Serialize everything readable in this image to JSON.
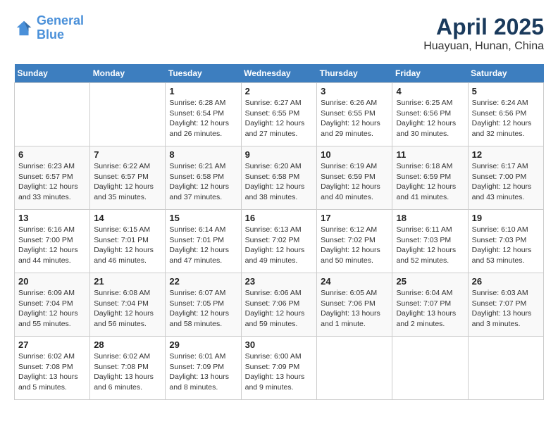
{
  "header": {
    "logo_line1": "General",
    "logo_line2": "Blue",
    "month": "April 2025",
    "location": "Huayuan, Hunan, China"
  },
  "weekdays": [
    "Sunday",
    "Monday",
    "Tuesday",
    "Wednesday",
    "Thursday",
    "Friday",
    "Saturday"
  ],
  "weeks": [
    [
      {
        "day": "",
        "info": ""
      },
      {
        "day": "",
        "info": ""
      },
      {
        "day": "1",
        "info": "Sunrise: 6:28 AM\nSunset: 6:54 PM\nDaylight: 12 hours\nand 26 minutes."
      },
      {
        "day": "2",
        "info": "Sunrise: 6:27 AM\nSunset: 6:55 PM\nDaylight: 12 hours\nand 27 minutes."
      },
      {
        "day": "3",
        "info": "Sunrise: 6:26 AM\nSunset: 6:55 PM\nDaylight: 12 hours\nand 29 minutes."
      },
      {
        "day": "4",
        "info": "Sunrise: 6:25 AM\nSunset: 6:56 PM\nDaylight: 12 hours\nand 30 minutes."
      },
      {
        "day": "5",
        "info": "Sunrise: 6:24 AM\nSunset: 6:56 PM\nDaylight: 12 hours\nand 32 minutes."
      }
    ],
    [
      {
        "day": "6",
        "info": "Sunrise: 6:23 AM\nSunset: 6:57 PM\nDaylight: 12 hours\nand 33 minutes."
      },
      {
        "day": "7",
        "info": "Sunrise: 6:22 AM\nSunset: 6:57 PM\nDaylight: 12 hours\nand 35 minutes."
      },
      {
        "day": "8",
        "info": "Sunrise: 6:21 AM\nSunset: 6:58 PM\nDaylight: 12 hours\nand 37 minutes."
      },
      {
        "day": "9",
        "info": "Sunrise: 6:20 AM\nSunset: 6:58 PM\nDaylight: 12 hours\nand 38 minutes."
      },
      {
        "day": "10",
        "info": "Sunrise: 6:19 AM\nSunset: 6:59 PM\nDaylight: 12 hours\nand 40 minutes."
      },
      {
        "day": "11",
        "info": "Sunrise: 6:18 AM\nSunset: 6:59 PM\nDaylight: 12 hours\nand 41 minutes."
      },
      {
        "day": "12",
        "info": "Sunrise: 6:17 AM\nSunset: 7:00 PM\nDaylight: 12 hours\nand 43 minutes."
      }
    ],
    [
      {
        "day": "13",
        "info": "Sunrise: 6:16 AM\nSunset: 7:00 PM\nDaylight: 12 hours\nand 44 minutes."
      },
      {
        "day": "14",
        "info": "Sunrise: 6:15 AM\nSunset: 7:01 PM\nDaylight: 12 hours\nand 46 minutes."
      },
      {
        "day": "15",
        "info": "Sunrise: 6:14 AM\nSunset: 7:01 PM\nDaylight: 12 hours\nand 47 minutes."
      },
      {
        "day": "16",
        "info": "Sunrise: 6:13 AM\nSunset: 7:02 PM\nDaylight: 12 hours\nand 49 minutes."
      },
      {
        "day": "17",
        "info": "Sunrise: 6:12 AM\nSunset: 7:02 PM\nDaylight: 12 hours\nand 50 minutes."
      },
      {
        "day": "18",
        "info": "Sunrise: 6:11 AM\nSunset: 7:03 PM\nDaylight: 12 hours\nand 52 minutes."
      },
      {
        "day": "19",
        "info": "Sunrise: 6:10 AM\nSunset: 7:03 PM\nDaylight: 12 hours\nand 53 minutes."
      }
    ],
    [
      {
        "day": "20",
        "info": "Sunrise: 6:09 AM\nSunset: 7:04 PM\nDaylight: 12 hours\nand 55 minutes."
      },
      {
        "day": "21",
        "info": "Sunrise: 6:08 AM\nSunset: 7:04 PM\nDaylight: 12 hours\nand 56 minutes."
      },
      {
        "day": "22",
        "info": "Sunrise: 6:07 AM\nSunset: 7:05 PM\nDaylight: 12 hours\nand 58 minutes."
      },
      {
        "day": "23",
        "info": "Sunrise: 6:06 AM\nSunset: 7:06 PM\nDaylight: 12 hours\nand 59 minutes."
      },
      {
        "day": "24",
        "info": "Sunrise: 6:05 AM\nSunset: 7:06 PM\nDaylight: 13 hours\nand 1 minute."
      },
      {
        "day": "25",
        "info": "Sunrise: 6:04 AM\nSunset: 7:07 PM\nDaylight: 13 hours\nand 2 minutes."
      },
      {
        "day": "26",
        "info": "Sunrise: 6:03 AM\nSunset: 7:07 PM\nDaylight: 13 hours\nand 3 minutes."
      }
    ],
    [
      {
        "day": "27",
        "info": "Sunrise: 6:02 AM\nSunset: 7:08 PM\nDaylight: 13 hours\nand 5 minutes."
      },
      {
        "day": "28",
        "info": "Sunrise: 6:02 AM\nSunset: 7:08 PM\nDaylight: 13 hours\nand 6 minutes."
      },
      {
        "day": "29",
        "info": "Sunrise: 6:01 AM\nSunset: 7:09 PM\nDaylight: 13 hours\nand 8 minutes."
      },
      {
        "day": "30",
        "info": "Sunrise: 6:00 AM\nSunset: 7:09 PM\nDaylight: 13 hours\nand 9 minutes."
      },
      {
        "day": "",
        "info": ""
      },
      {
        "day": "",
        "info": ""
      },
      {
        "day": "",
        "info": ""
      }
    ]
  ]
}
